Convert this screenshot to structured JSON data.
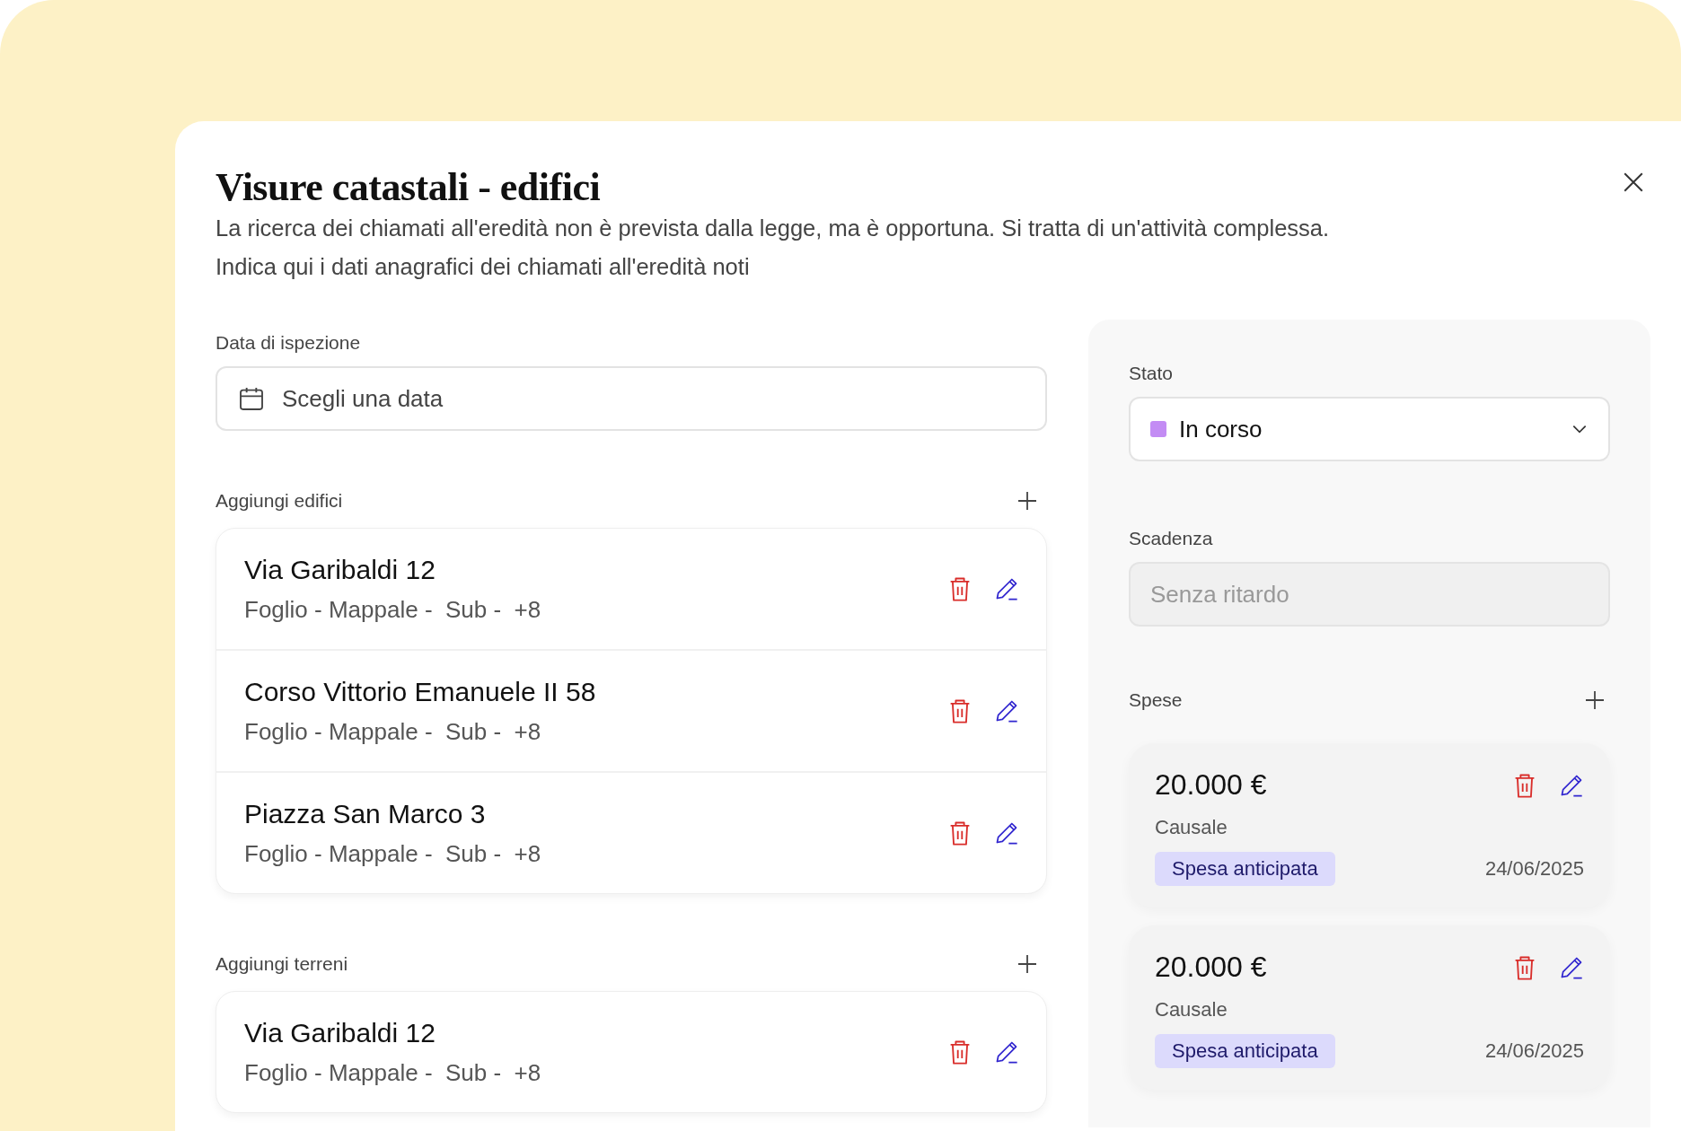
{
  "dialog": {
    "title": "Visure catastali - edifici",
    "description_lines": [
      "La ricerca dei chiamati all'eredità non è prevista dalla legge, ma è opportuna. Si tratta di un'attività complessa.",
      "Indica qui i dati anagrafici dei chiamati all'eredità noti"
    ]
  },
  "inspection_date": {
    "label": "Data di ispezione",
    "placeholder": "Scegli una data"
  },
  "buildings": {
    "label": "Aggiungi edifici",
    "items": [
      {
        "name": "Via Garibaldi 12",
        "details": "Foglio - Mappale -  Sub -  +8"
      },
      {
        "name": "Corso Vittorio Emanuele II 58",
        "details": "Foglio - Mappale -  Sub -  +8"
      },
      {
        "name": "Piazza San Marco 3",
        "details": "Foglio - Mappale -  Sub -  +8"
      }
    ]
  },
  "lands": {
    "label": "Aggiungi terreni",
    "items": [
      {
        "name": "Via Garibaldi 12",
        "details": "Foglio - Mappale -  Sub -  +8"
      }
    ]
  },
  "status": {
    "label": "Stato",
    "value": "In corso",
    "color": "#c38cf4"
  },
  "deadline": {
    "label": "Scadenza",
    "placeholder": "Senza ritardo",
    "disabled": true
  },
  "expenses": {
    "label": "Spese",
    "items": [
      {
        "amount": "20.000 €",
        "reason": "Causale",
        "tag": "Spesa anticipata",
        "date": "24/06/2025"
      },
      {
        "amount": "20.000 €",
        "reason": "Causale",
        "tag": "Spesa anticipata",
        "date": "24/06/2025"
      }
    ]
  }
}
